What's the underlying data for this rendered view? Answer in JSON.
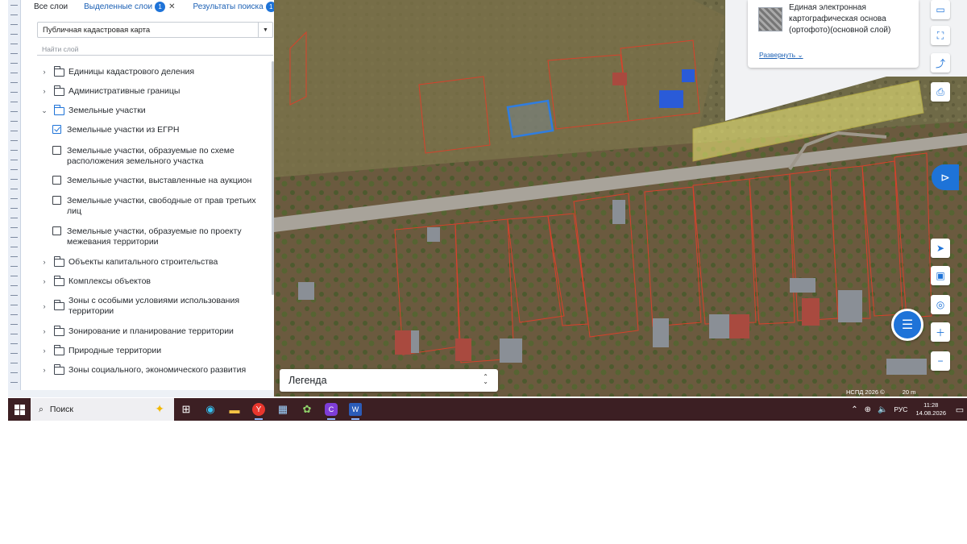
{
  "tabs": {
    "all_layers": "Все слои",
    "selected_layers": "Выделенные слои",
    "selected_count": "1",
    "search_results": "Результаты поиска",
    "search_count": "1"
  },
  "basemap": {
    "value": "Публичная кадастровая карта"
  },
  "layer_search": {
    "placeholder": "Найти слой"
  },
  "layers": [
    {
      "kind": "folder",
      "label": "Единицы кадастрового деления",
      "expanded": false
    },
    {
      "kind": "folder",
      "label": "Административные границы",
      "expanded": false
    },
    {
      "kind": "folder",
      "label": "Земельные участки",
      "expanded": true
    },
    {
      "kind": "check",
      "label": "Земельные участки из ЕГРН",
      "checked": true
    },
    {
      "kind": "check",
      "label": "Земельные участки, образуемые по схеме расположения земельного участка",
      "checked": false
    },
    {
      "kind": "check",
      "label": "Земельные участки, выставленные на аукцион",
      "checked": false
    },
    {
      "kind": "check",
      "label": "Земельные участки, свободные от прав третьих лиц",
      "checked": false
    },
    {
      "kind": "check",
      "label": "Земельные участки, образуемые по проекту межевания территории",
      "checked": false
    },
    {
      "kind": "folder",
      "label": "Объекты капитального строительства",
      "expanded": false
    },
    {
      "kind": "folder",
      "label": "Комплексы объектов",
      "expanded": false
    },
    {
      "kind": "folder",
      "label": "Зоны с особыми условиями использования территории",
      "expanded": false
    },
    {
      "kind": "folder",
      "label": "Зонирование и планирование территории",
      "expanded": false
    },
    {
      "kind": "folder",
      "label": "Природные территории",
      "expanded": false
    },
    {
      "kind": "folder",
      "label": "Зоны социального, экономического развития",
      "expanded": false
    }
  ],
  "info_card": {
    "title": "Единая электронная картографическая основа (ортофото)(основной слой)",
    "expand_label": "Развернуть"
  },
  "legend": {
    "label": "Легенда"
  },
  "map_footer": {
    "copyright": "НСПД 2026 ©",
    "scale": "20 m"
  },
  "icons": {
    "ruler": "ruler-icon",
    "measure_area": "measure-area-icon",
    "share": "share-icon",
    "print": "print-icon",
    "locate": "navigate-icon",
    "picture_in_picture": "window-icon",
    "geolocation": "geolocation-icon",
    "zoom_in": "plus-icon",
    "zoom_out": "minus-icon",
    "chat": "chat-icon"
  },
  "taskbar": {
    "search_label": "Поиск",
    "language": "РУС",
    "time": "11:28",
    "date": "14.08.2026"
  },
  "colors": {
    "accent": "#1e73d8",
    "taskbar": "#3c1f23",
    "parcel_outline": "#d8412b",
    "selected_parcel": "#2f7de0",
    "zone_fill": "#f2ee7a"
  }
}
